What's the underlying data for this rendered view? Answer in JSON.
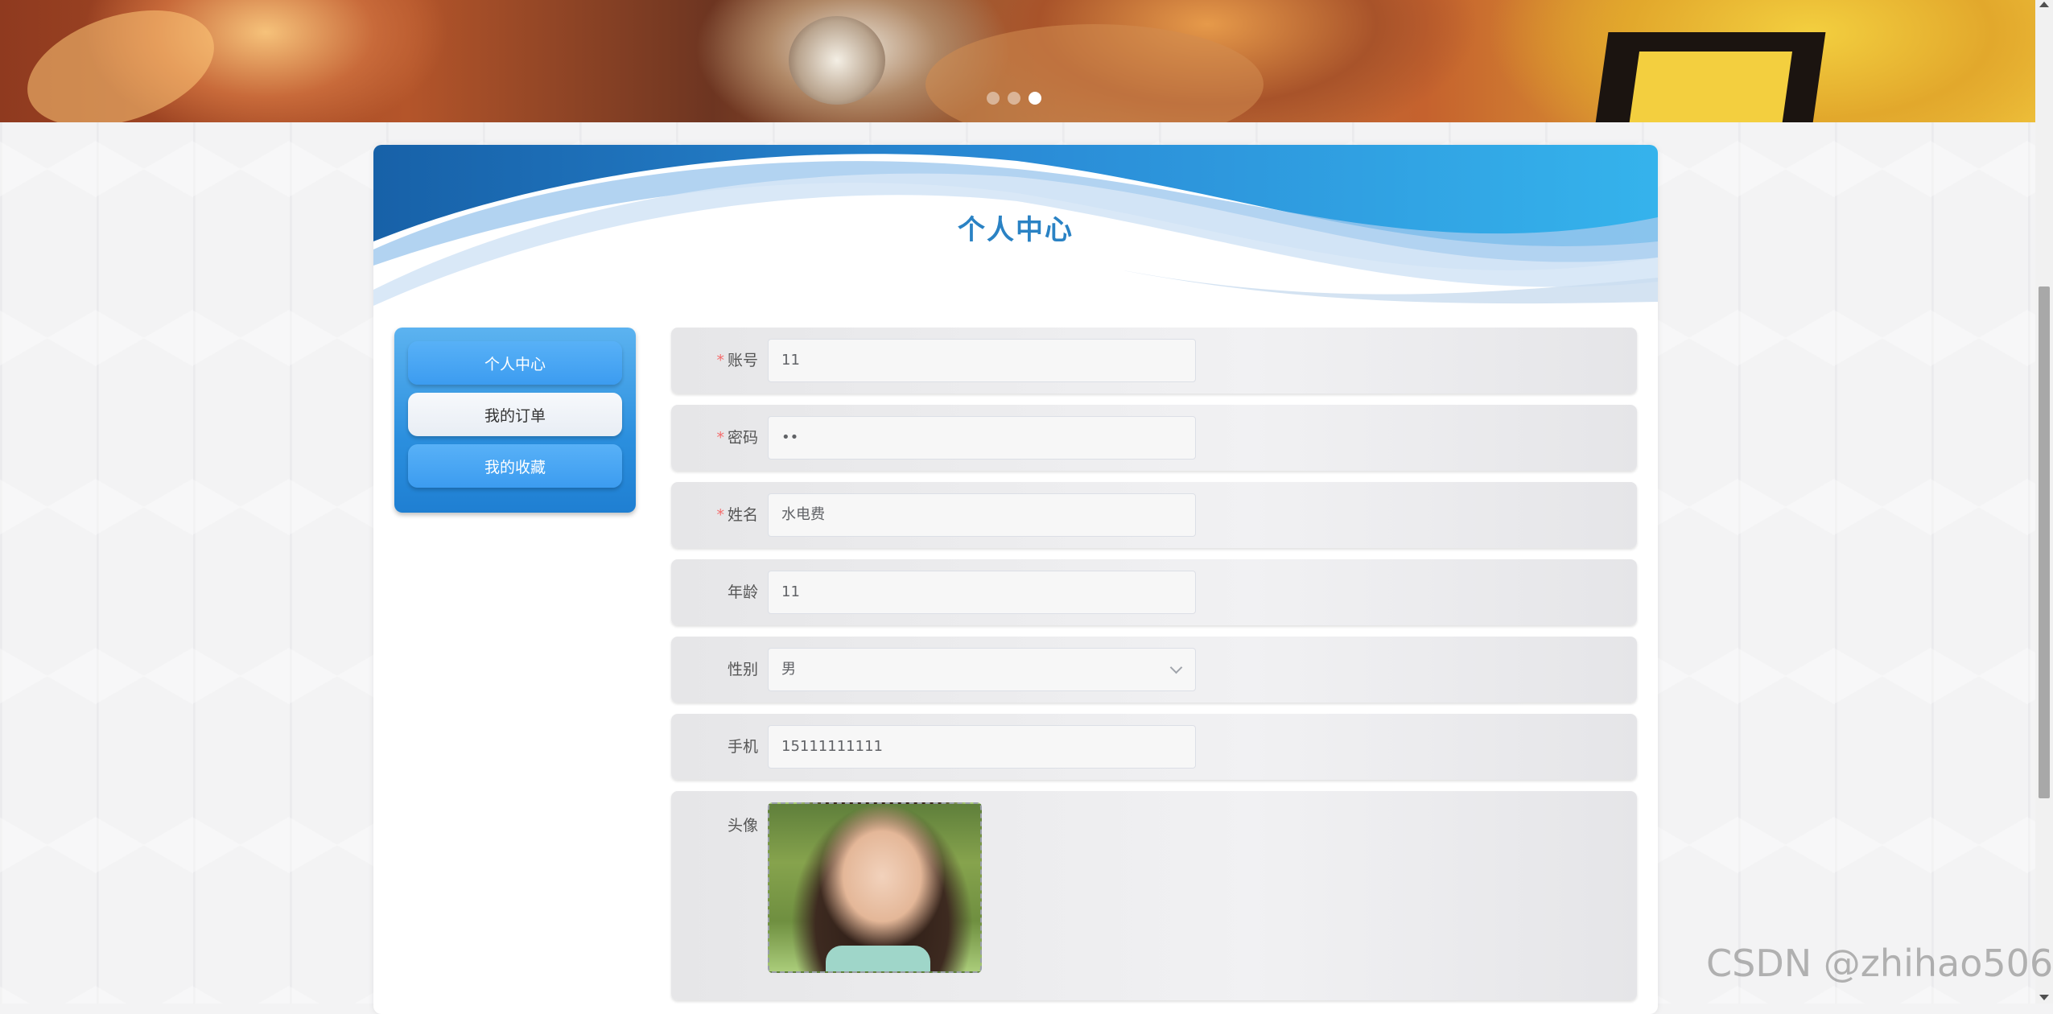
{
  "banner": {
    "carousel_dots": [
      false,
      false,
      true
    ]
  },
  "page": {
    "title": "个人中心"
  },
  "side_menu": {
    "items": [
      {
        "label": "个人中心",
        "active": false
      },
      {
        "label": "我的订单",
        "active": true
      },
      {
        "label": "我的收藏",
        "active": false
      }
    ]
  },
  "form": {
    "account": {
      "label": "账号",
      "required": "*",
      "value": "11"
    },
    "password": {
      "label": "密码",
      "required": "*",
      "value": "••"
    },
    "name": {
      "label": "姓名",
      "required": "*",
      "value": "水电费"
    },
    "age": {
      "label": "年龄",
      "value": "11"
    },
    "gender": {
      "label": "性别",
      "value": "男"
    },
    "phone": {
      "label": "手机",
      "value": "15111111111"
    },
    "avatar": {
      "label": "头像"
    }
  },
  "colors": {
    "accent": "#2a82c4",
    "menu_blue": "#3c9cf0",
    "required": "#f56c6c"
  },
  "watermark": "CSDN @zhihao506"
}
